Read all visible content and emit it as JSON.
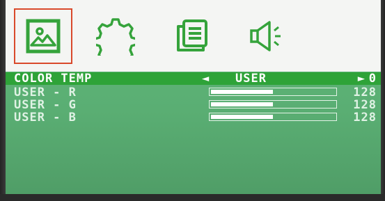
{
  "tabs": [
    {
      "name": "picture",
      "icon": "picture-icon",
      "active": true
    },
    {
      "name": "settings",
      "icon": "gear-icon",
      "active": false
    },
    {
      "name": "document",
      "icon": "document-icon",
      "active": false
    },
    {
      "name": "audio",
      "icon": "speaker-icon",
      "active": false
    }
  ],
  "color_temp": {
    "label": "COLOR TEMP",
    "left_arrow": "◄",
    "value": "USER",
    "right_arrow": "►",
    "index": "0"
  },
  "user_r": {
    "label": "USER - R",
    "value": "128",
    "level": 0.5
  },
  "user_g": {
    "label": "USER - G",
    "value": "128",
    "level": 0.5
  },
  "user_b": {
    "label": "USER - B",
    "value": "128",
    "level": 0.5
  },
  "colors": {
    "accent": "#2ea338",
    "selected_tab_border": "#d9492b",
    "icon_green": "#35a33b"
  }
}
